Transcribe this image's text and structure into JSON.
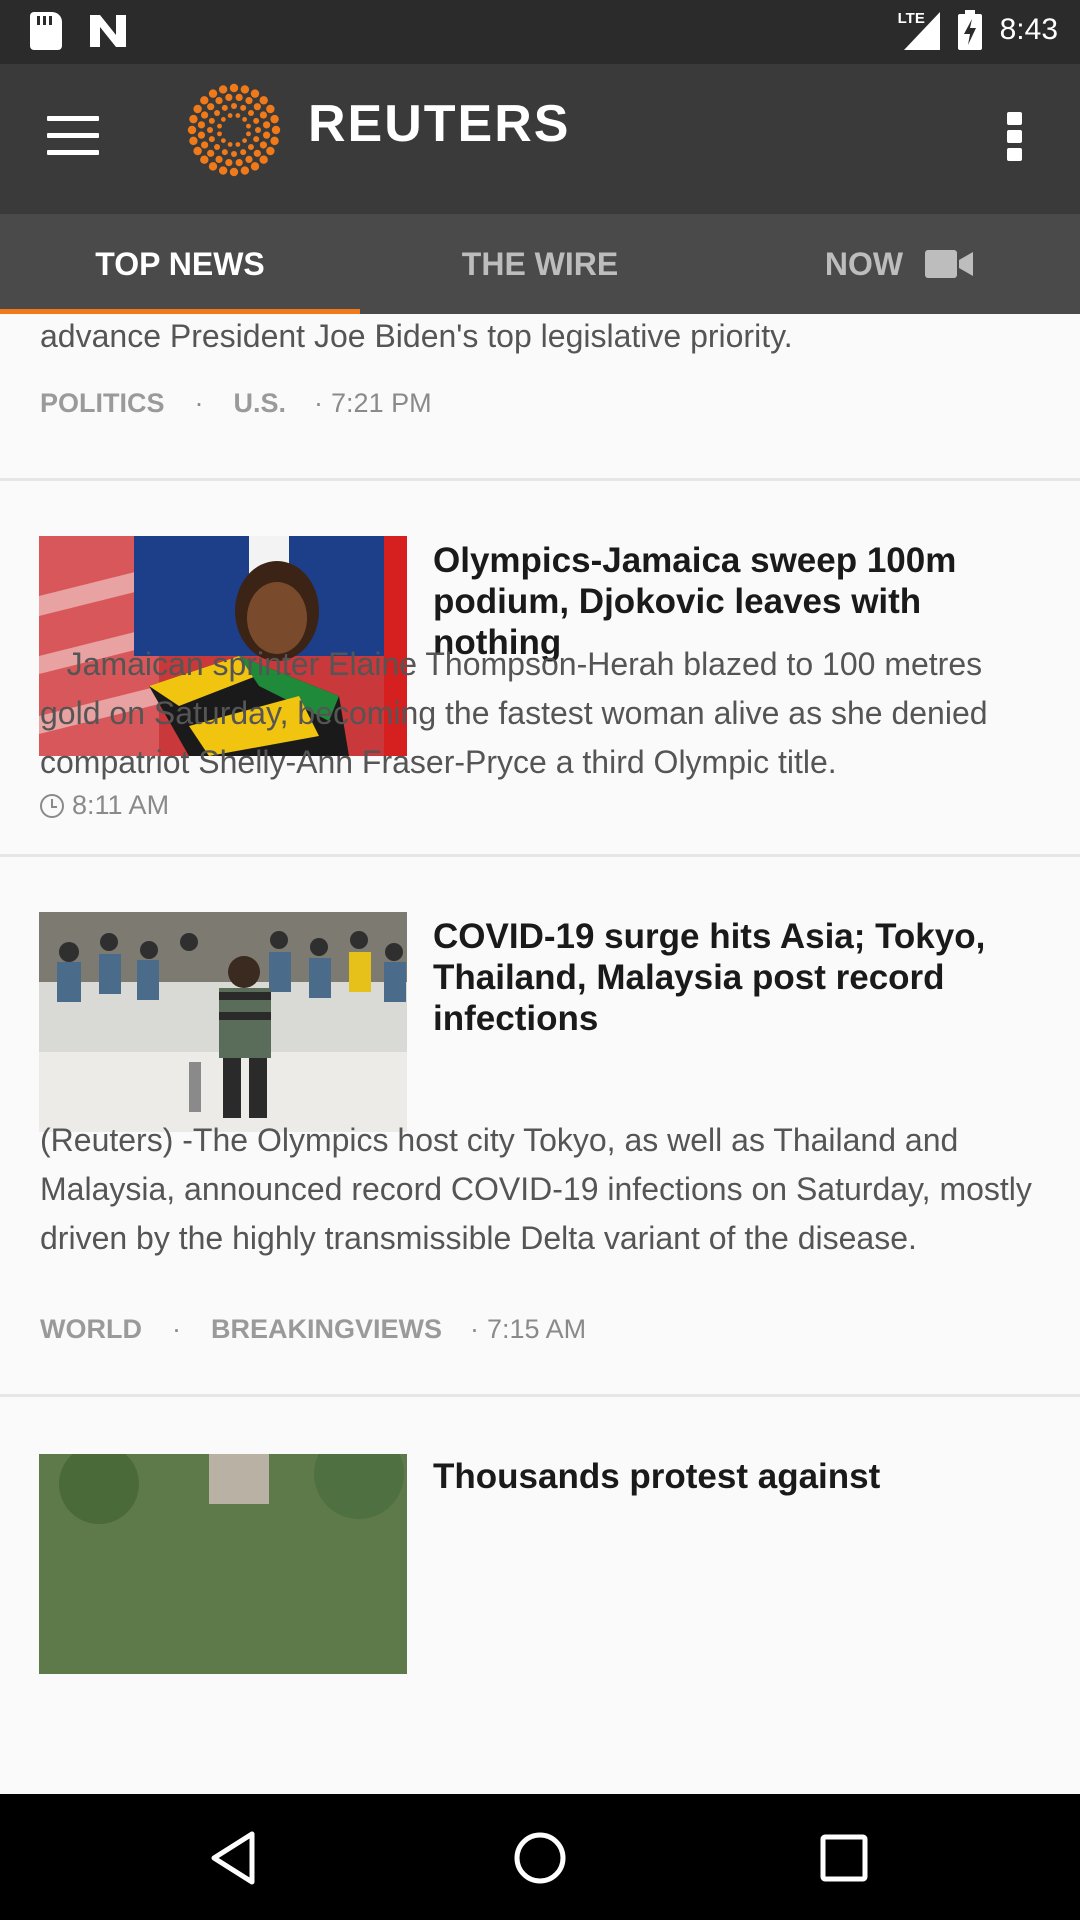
{
  "status_bar": {
    "icons": [
      "sd-card-icon",
      "n-app-icon",
      "lte-signal-icon",
      "battery-charging-icon"
    ],
    "network": "LTE",
    "time": "8:43"
  },
  "app_bar": {
    "brand": "REUTERS",
    "brand_color": "#f07a1a",
    "menu_icon": "hamburger-menu-icon",
    "overflow_icon": "more-vert-icon"
  },
  "tabs": [
    {
      "label": "TOP NEWS",
      "active": true
    },
    {
      "label": "THE WIRE",
      "active": false
    },
    {
      "label": "NOW",
      "active": false,
      "icon": "video-camera-icon"
    }
  ],
  "articles": {
    "prev": {
      "snippet": "advance President Joe Biden's top legislative priority.",
      "tags": [
        "POLITICS",
        "U.S."
      ],
      "time": "7:21 PM"
    },
    "a1": {
      "headline": "Olympics-Jamaica sweep 100m podium, Djokovic leaves with nothing",
      "body": "   Jamaican sprinter Elaine Thompson-Herah blazed to 100 metres gold on Saturday, becoming the fastest woman alive as she denied compatriot Shelly-Ann Fraser-Pryce a third Olympic title.",
      "time": "8:11 AM",
      "image": "sprinter-with-jamaican-flag"
    },
    "a2": {
      "headline": "COVID-19 surge hits Asia; Tokyo, Thailand, Malaysia post record infections",
      "body": "(Reuters) -The Olympics host city Tokyo, as well as Thailand and Malaysia, announced record COVID-19 infections on Saturday, mostly driven by the highly transmissible Delta variant of the disease.",
      "tags": [
        "WORLD",
        "BREAKINGVIEWS"
      ],
      "time": "7:15 AM",
      "image": "people-waiting-seated-masks"
    },
    "a3": {
      "headline": "Thousands protest against",
      "image": "building-and-trees"
    }
  },
  "nav_bar": {
    "buttons": [
      "back-icon",
      "home-icon",
      "recents-icon"
    ]
  }
}
